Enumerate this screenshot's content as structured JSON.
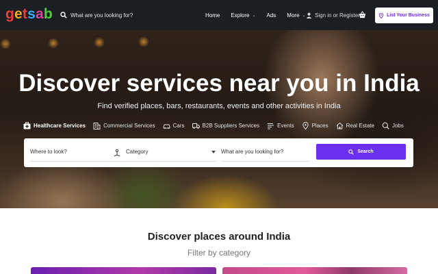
{
  "header": {
    "logo": {
      "letters": [
        "g",
        "e",
        "t",
        "s",
        "a",
        "b"
      ],
      "colors": [
        "#f03c3c",
        "#f5a623",
        "#f03c3c",
        "#3fa9f5",
        "#e040a0",
        "#4cd137"
      ]
    },
    "search_placeholder": "What are you looking for?",
    "nav": [
      {
        "label": "Home",
        "has_dropdown": false
      },
      {
        "label": "Explore",
        "has_dropdown": true
      },
      {
        "label": "Ads",
        "has_dropdown": false
      },
      {
        "label": "More",
        "has_dropdown": true
      }
    ],
    "signin_label": "Sign in or Register",
    "list_business_label": "List Your Business"
  },
  "hero": {
    "title": "Discover services near you in India",
    "subtitle": "Find verified places, bars, restaurants, events and other activities in India",
    "categories": [
      {
        "label": "Healthcare Services",
        "icon": "medical-bag-icon",
        "active": true
      },
      {
        "label": "Commercial Services",
        "icon": "building-icon",
        "active": false
      },
      {
        "label": "Cars",
        "icon": "car-icon",
        "active": false
      },
      {
        "label": "B2B Suppliers Services",
        "icon": "truck-icon",
        "active": false
      },
      {
        "label": "Events",
        "icon": "calendar-icon",
        "active": false
      },
      {
        "label": "Places",
        "icon": "map-pin-icon",
        "active": false
      },
      {
        "label": "Real Estate",
        "icon": "home-icon",
        "active": false
      },
      {
        "label": "Jobs",
        "icon": "magnifier-icon",
        "active": false
      }
    ],
    "search": {
      "where_placeholder": "Where to look?",
      "category_label": "Category",
      "what_placeholder": "What are you looking for?",
      "button_label": "Search"
    }
  },
  "section": {
    "title": "Discover places around India",
    "subtitle": "Filter by category"
  },
  "colors": {
    "accent": "#6b2ff0",
    "header_bg": "#1b1f24"
  }
}
